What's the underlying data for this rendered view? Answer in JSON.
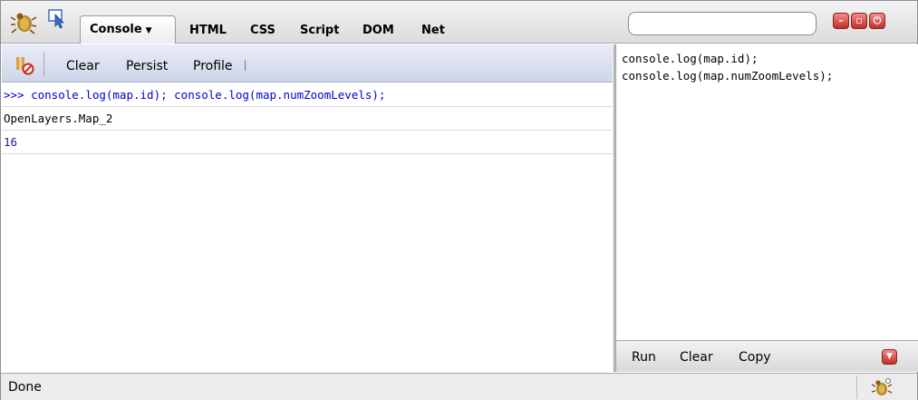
{
  "toolbar": {
    "tabs": {
      "console": "Console",
      "html": "HTML",
      "css": "CSS",
      "script": "Script",
      "dom": "DOM",
      "net": "Net"
    },
    "search_value": ""
  },
  "console_toolbar": {
    "clear": "Clear",
    "persist": "Persist",
    "profile": "Profile"
  },
  "log": {
    "rows": [
      ">>> console.log(map.id); console.log(map.numZoomLevels);",
      "OpenLayers.Map_2",
      "16"
    ]
  },
  "editor": {
    "lines": [
      "console.log(map.id);",
      "console.log(map.numZoomLevels);"
    ]
  },
  "editor_bar": {
    "run": "Run",
    "clear": "Clear",
    "copy": "Copy"
  },
  "status": {
    "text": "Done"
  },
  "colors": {
    "accent_red": "#c0302a",
    "command_blue": "#0000cc"
  }
}
